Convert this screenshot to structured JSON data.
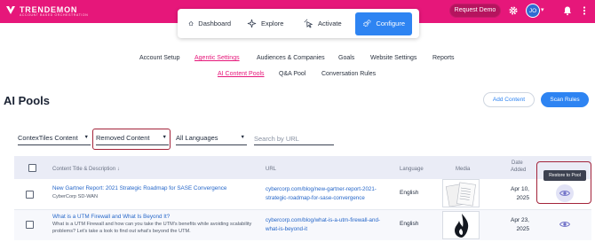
{
  "app": {
    "logo_name": "TRENDEMON",
    "logo_tagline": "ACCOUNT BASED ORCHESTRATION",
    "request_demo": "Request Demo",
    "avatar_initials": "JO"
  },
  "main_nav": [
    {
      "label": "Dashboard",
      "icon": "home-icon"
    },
    {
      "label": "Explore",
      "icon": "sparkle-icon"
    },
    {
      "label": "Activate",
      "icon": "cursor-click-icon"
    },
    {
      "label": "Configure",
      "icon": "gears-icon",
      "active": true
    }
  ],
  "sub_nav": [
    {
      "label": "Account Setup"
    },
    {
      "label": "Agentic Settings",
      "active": true
    },
    {
      "label": "Audiences & Companies"
    },
    {
      "label": "Goals"
    },
    {
      "label": "Website Settings"
    },
    {
      "label": "Reports"
    }
  ],
  "sub_nav_2": [
    {
      "label": "AI Content Pools",
      "active": true
    },
    {
      "label": "Q&A Pool"
    },
    {
      "label": "Conversation Rules"
    }
  ],
  "page": {
    "title": "AI Pools",
    "add_content": "Add Content",
    "scan_rules": "Scan Rules"
  },
  "filters": {
    "content_type": "ContexTiles Content",
    "status": "Removed Content",
    "language": "All Languages",
    "search_placeholder": "Search by URL"
  },
  "table": {
    "headers": {
      "title": "Content Title & Description ↓",
      "url": "URL",
      "language": "Language",
      "media": "Media",
      "date_line1": "Date",
      "date_line2": "Added"
    },
    "tooltip": "Restore to Pool",
    "rows": [
      {
        "title": "New Gartner Report: 2021 Strategic Roadmap for SASE Convergence",
        "desc1": "CyberCorp SD-WAN",
        "desc2": "",
        "url1": "cybercorp.com/blog/new-gartner-report-2021-",
        "url2": "strategic-roadmap-for-sase-convergence",
        "language": "English",
        "media": "report-document-thumbnail",
        "date1": "Apr 10,",
        "date2": "2025"
      },
      {
        "title": "What is a UTM Firewall and What Is Beyond It?",
        "desc1": "What is a UTM Firewall and how can you take the UTM's benefits while avoiding scalability",
        "desc2": "problems? Let's take a look to find out what's beyond the UTM.",
        "url1": "cybercorp.com/blog/what-is-a-utm-firewall-and-",
        "url2": "what-is-beyond-it",
        "language": "English",
        "media": "flame-logo-thumbnail",
        "date1": "Apr 23,",
        "date2": "2025"
      }
    ]
  },
  "colors": {
    "brand_pink": "#e6177a",
    "accent_blue": "#2e84f2",
    "highlight_red": "#a3233a"
  }
}
